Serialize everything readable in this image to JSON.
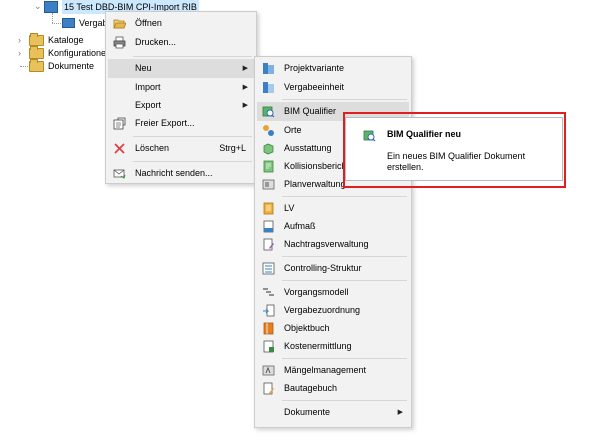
{
  "colors": {
    "menu_bg": "#f2f2f2",
    "menu_highlight": "#dddddd",
    "tree_selection": "#cce8ff",
    "callout_border": "#e02020",
    "folder": "#e9c15a",
    "project_icon": "#3b7fc4"
  },
  "tree": {
    "project": "15 Test DBD-BIM CPI-Import RIB",
    "vergabe_fragment": "Vergabe",
    "folders": [
      {
        "name": "Kataloge",
        "collapsed_icon": "chevron-right-icon"
      },
      {
        "name": "Konfigurationen",
        "collapsed_icon": "chevron-right-icon"
      },
      {
        "name": "Dokumente",
        "collapsed_icon": ""
      }
    ]
  },
  "context_menu": {
    "items": [
      {
        "label": "Öffnen",
        "icon": "open-folder-icon"
      },
      {
        "label": "Drucken...",
        "icon": "printer-icon"
      },
      {
        "label": "Neu",
        "icon": "",
        "submenu": true,
        "highlighted": true
      },
      {
        "label": "Import",
        "icon": "",
        "submenu": true
      },
      {
        "label": "Export",
        "icon": "",
        "submenu": true
      },
      {
        "label": "Freier Export...",
        "icon": "free-export-icon"
      },
      {
        "label": "Löschen",
        "icon": "delete-x-icon",
        "shortcut": "Strg+L"
      },
      {
        "label": "Nachricht senden...",
        "icon": "send-message-icon"
      }
    ]
  },
  "submenu_neu": {
    "items": [
      {
        "label": "Projektvariante",
        "icon": "project-variant-icon"
      },
      {
        "label": "Vergabeeinheit",
        "icon": "award-unit-icon"
      },
      {
        "label": "BIM Qualifier",
        "icon": "bim-qualifier-icon",
        "highlighted": true
      },
      {
        "label": "Orte",
        "icon": "locations-icon"
      },
      {
        "label": "Ausstattung",
        "icon": "equipment-icon"
      },
      {
        "label": "Kollisionsbericht",
        "icon": "collision-report-icon"
      },
      {
        "label": "Planverwaltung",
        "icon": "plan-management-icon"
      },
      {
        "label": "LV",
        "icon": "lv-icon"
      },
      {
        "label": "Aufmaß",
        "icon": "measurement-icon"
      },
      {
        "label": "Nachtragsverwaltung",
        "icon": "supplement-management-icon"
      },
      {
        "label": "Controlling-Struktur",
        "icon": "controlling-structure-icon"
      },
      {
        "label": "Vorgangsmodell",
        "icon": "process-model-icon"
      },
      {
        "label": "Vergabezuordnung",
        "icon": "award-assignment-icon"
      },
      {
        "label": "Objektbuch",
        "icon": "object-book-icon"
      },
      {
        "label": "Kostenermittlung",
        "icon": "cost-estimation-icon"
      },
      {
        "label": "Mängelmanagement",
        "icon": "defect-management-icon"
      },
      {
        "label": "Bautagebuch",
        "icon": "construction-diary-icon"
      },
      {
        "label": "Dokumente",
        "icon": "",
        "submenu": true
      }
    ]
  },
  "tooltip": {
    "title": "BIM Qualifier neu",
    "description": "Ein neues BIM Qualifier Dokument erstellen.",
    "icon": "bim-qualifier-icon"
  }
}
